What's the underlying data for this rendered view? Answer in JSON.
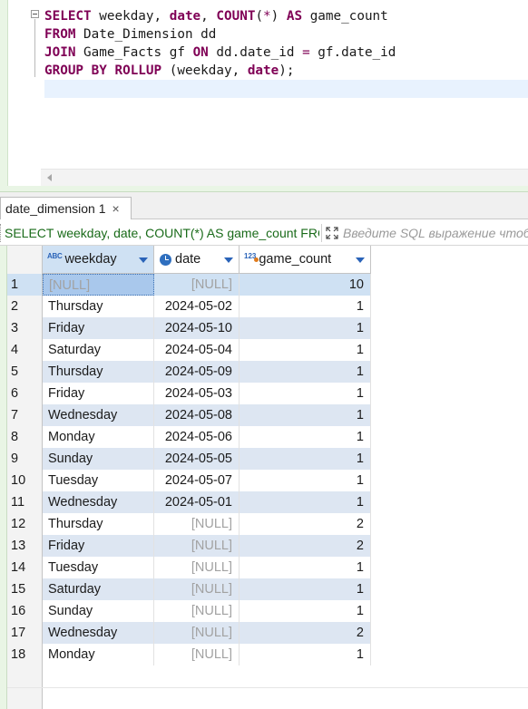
{
  "editor": {
    "lines": [
      [
        {
          "t": "SELECT",
          "k": "kw"
        },
        {
          "t": " weekday, ",
          "k": ""
        },
        {
          "t": "date",
          "k": "kw"
        },
        {
          "t": ", ",
          "k": ""
        },
        {
          "t": "COUNT",
          "k": "kw"
        },
        {
          "t": "(",
          "k": ""
        },
        {
          "t": "*",
          "k": "op"
        },
        {
          "t": ") ",
          "k": ""
        },
        {
          "t": "AS",
          "k": "kw"
        },
        {
          "t": " game_count",
          "k": ""
        }
      ],
      [
        {
          "t": "FROM",
          "k": "kw"
        },
        {
          "t": " Date_Dimension dd",
          "k": ""
        }
      ],
      [
        {
          "t": "JOIN",
          "k": "kw"
        },
        {
          "t": " Game_Facts gf ",
          "k": ""
        },
        {
          "t": "ON",
          "k": "kw"
        },
        {
          "t": " dd.date_id ",
          "k": ""
        },
        {
          "t": "=",
          "k": "op"
        },
        {
          "t": " gf.date_id",
          "k": ""
        }
      ],
      [
        {
          "t": "GROUP BY",
          "k": "kw"
        },
        {
          "t": " ",
          "k": ""
        },
        {
          "t": "ROLLUP",
          "k": "kw"
        },
        {
          "t": " (weekday, ",
          "k": ""
        },
        {
          "t": "date",
          "k": "kw"
        },
        {
          "t": ");",
          "k": ""
        }
      ]
    ]
  },
  "results_tab": {
    "label": "date_dimension 1",
    "close_glyph": "×"
  },
  "filter_bar": {
    "query_text": "SELECT weekday, date, COUNT(*) AS game_count FROM Date_Dimension dd",
    "filter_placeholder": "Введите SQL выражение чтобы отфильтровать результаты"
  },
  "grid": {
    "columns": [
      {
        "label": "weekday",
        "type_icon": "ABC"
      },
      {
        "label": "date",
        "type_icon": "clock-icon"
      },
      {
        "label": "game_count",
        "type_icon": "123"
      }
    ],
    "rows": [
      {
        "n": "1",
        "weekday": "[NULL]",
        "date": "[NULL]",
        "game_count": "10"
      },
      {
        "n": "2",
        "weekday": "Thursday",
        "date": "2024-05-02",
        "game_count": "1"
      },
      {
        "n": "3",
        "weekday": "Friday",
        "date": "2024-05-10",
        "game_count": "1"
      },
      {
        "n": "4",
        "weekday": "Saturday",
        "date": "2024-05-04",
        "game_count": "1"
      },
      {
        "n": "5",
        "weekday": "Thursday",
        "date": "2024-05-09",
        "game_count": "1"
      },
      {
        "n": "6",
        "weekday": "Friday",
        "date": "2024-05-03",
        "game_count": "1"
      },
      {
        "n": "7",
        "weekday": "Wednesday",
        "date": "2024-05-08",
        "game_count": "1"
      },
      {
        "n": "8",
        "weekday": "Monday",
        "date": "2024-05-06",
        "game_count": "1"
      },
      {
        "n": "9",
        "weekday": "Sunday",
        "date": "2024-05-05",
        "game_count": "1"
      },
      {
        "n": "10",
        "weekday": "Tuesday",
        "date": "2024-05-07",
        "game_count": "1"
      },
      {
        "n": "11",
        "weekday": "Wednesday",
        "date": "2024-05-01",
        "game_count": "1"
      },
      {
        "n": "12",
        "weekday": "Thursday",
        "date": "[NULL]",
        "game_count": "2"
      },
      {
        "n": "13",
        "weekday": "Friday",
        "date": "[NULL]",
        "game_count": "2"
      },
      {
        "n": "14",
        "weekday": "Tuesday",
        "date": "[NULL]",
        "game_count": "1"
      },
      {
        "n": "15",
        "weekday": "Saturday",
        "date": "[NULL]",
        "game_count": "1"
      },
      {
        "n": "16",
        "weekday": "Sunday",
        "date": "[NULL]",
        "game_count": "1"
      },
      {
        "n": "17",
        "weekday": "Wednesday",
        "date": "[NULL]",
        "game_count": "2"
      },
      {
        "n": "18",
        "weekday": "Monday",
        "date": "[NULL]",
        "game_count": "1"
      }
    ]
  },
  "colors": {
    "keyword": "#7f0055",
    "row_alt": "#dde6f2",
    "selection": "#cfe1f3",
    "null_text": "#a2a2a2",
    "filter_query": "#1a6b1a"
  }
}
